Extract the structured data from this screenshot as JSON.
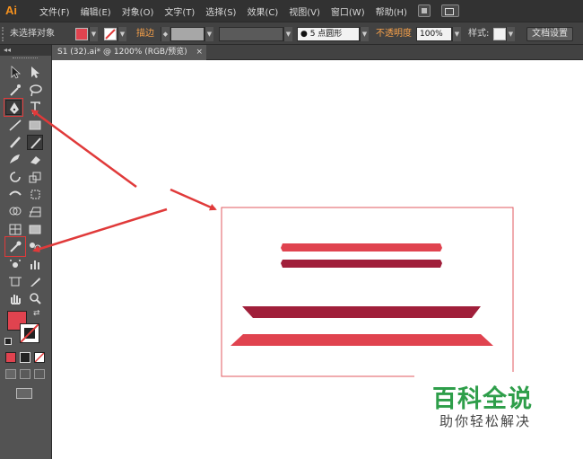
{
  "app": {
    "logo": "Ai"
  },
  "menu": {
    "items": [
      "文件(F)",
      "编辑(E)",
      "对象(O)",
      "文字(T)",
      "选择(S)",
      "效果(C)",
      "视图(V)",
      "窗口(W)",
      "帮助(H)"
    ]
  },
  "controlbar": {
    "selection_status": "未选择对象",
    "stroke_label": "描边",
    "brush_label": "5 点圆形",
    "opacity_label": "不透明度",
    "opacity_value": "100%",
    "style_label": "样式:",
    "document_setup": "文档设置",
    "fill_color": "#e0434f"
  },
  "tabs": [
    {
      "title": "S1 (32).ai* @ 1200% (RGB/预览)",
      "close": "×"
    }
  ],
  "toolbox": {
    "header": "◂◂",
    "fill_color": "#e0434f",
    "tools": [
      "selection-tool",
      "direct-selection-tool",
      "magic-wand-tool",
      "lasso-tool",
      "pen-tool",
      "type-tool",
      "line-tool",
      "rectangle-tool",
      "paintbrush-tool",
      "pencil-tool",
      "blob-brush-tool",
      "eraser-tool",
      "rotate-tool",
      "scale-tool",
      "width-tool",
      "free-transform-tool",
      "shape-builder-tool",
      "perspective-grid-tool",
      "mesh-tool",
      "gradient-tool",
      "eyedropper-tool",
      "blend-tool",
      "symbol-sprayer-tool",
      "column-graph-tool",
      "artboard-tool",
      "slice-tool",
      "hand-tool",
      "zoom-tool"
    ]
  },
  "artwork": {
    "shape_colors": {
      "light": "#e0434f",
      "dark": "#a01f3a"
    }
  },
  "watermark": {
    "title": "百科全说",
    "subtitle": "助你轻松解决"
  },
  "annotation_color": "#e03a3a"
}
